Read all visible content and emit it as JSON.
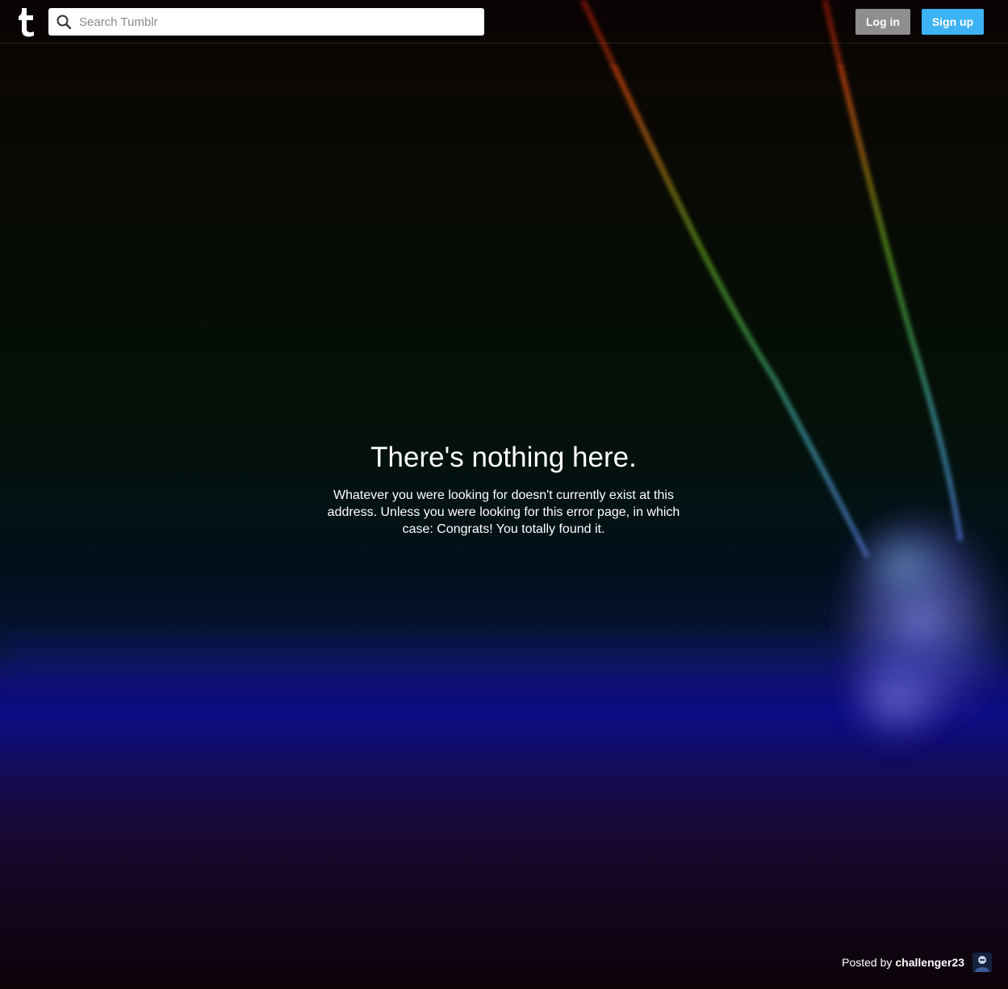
{
  "header": {
    "search": {
      "placeholder": "Search Tumblr",
      "value": ""
    },
    "login_label": "Log in",
    "signup_label": "Sign up"
  },
  "error": {
    "title": "There's nothing here.",
    "message": "Whatever you were looking for doesn't currently exist at this address. Unless you were looking for this error page, in which case: Congrats! You totally found it."
  },
  "credit": {
    "prefix": "Posted by",
    "username": "challenger23"
  },
  "colors": {
    "login_button": "#8e8e8e",
    "signup_button": "#3db2f5",
    "search_background": "#ffffff"
  },
  "icons": {
    "logo": "tumblr-logo-icon",
    "search": "search-icon"
  }
}
